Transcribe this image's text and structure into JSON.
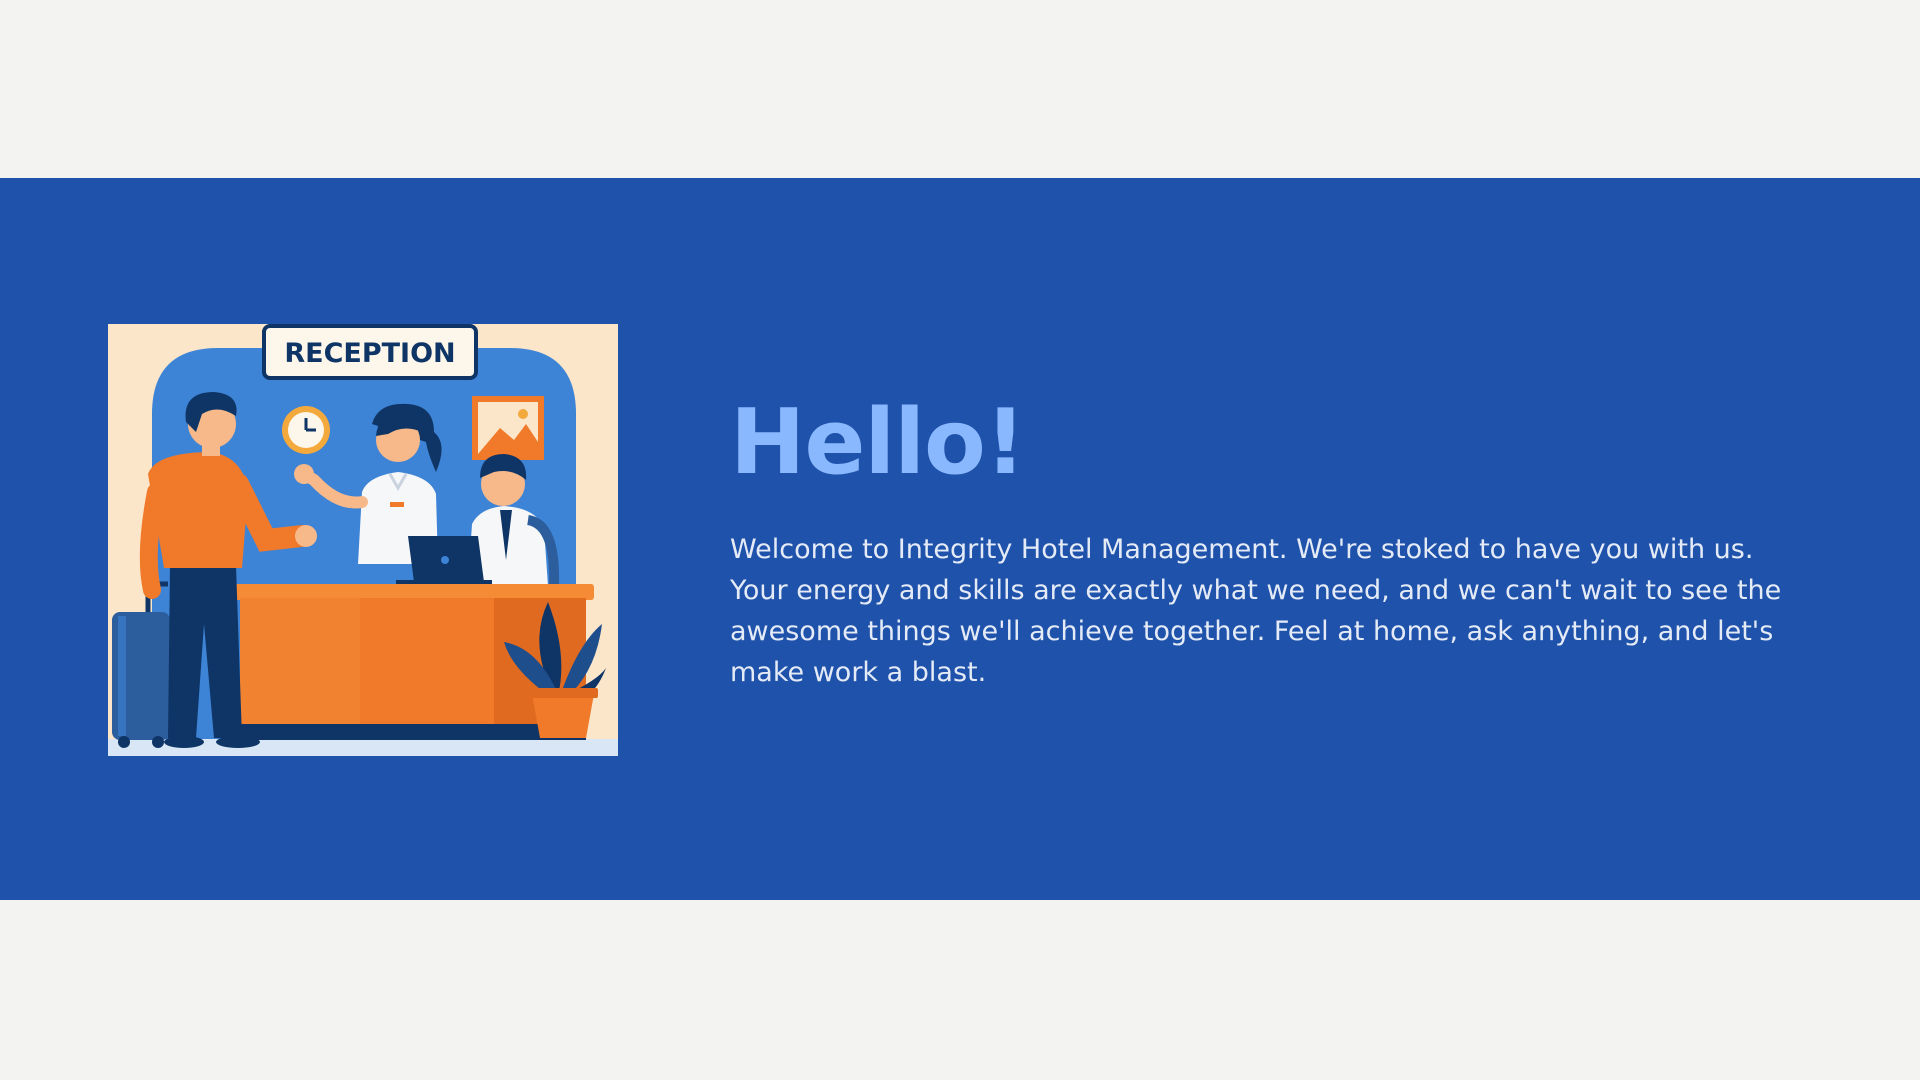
{
  "banner": {
    "illustration": {
      "sign_text": "RECEPTION"
    },
    "heading": "Hello!",
    "message": "Welcome to Integrity Hotel Management. We're stoked to have you with us. Your energy and skills are exactly what we need, and we can't wait to see the awesome things we'll achieve together. Feel at home, ask anything, and let's make work a blast."
  },
  "colors": {
    "page_background": "#f3f3f1",
    "banner_background": "#1f52aa",
    "heading": "#8ab8ff",
    "body_text": "#e4ebf7",
    "illustration_orange": "#f07a2a",
    "illustration_navy": "#0f3566"
  }
}
